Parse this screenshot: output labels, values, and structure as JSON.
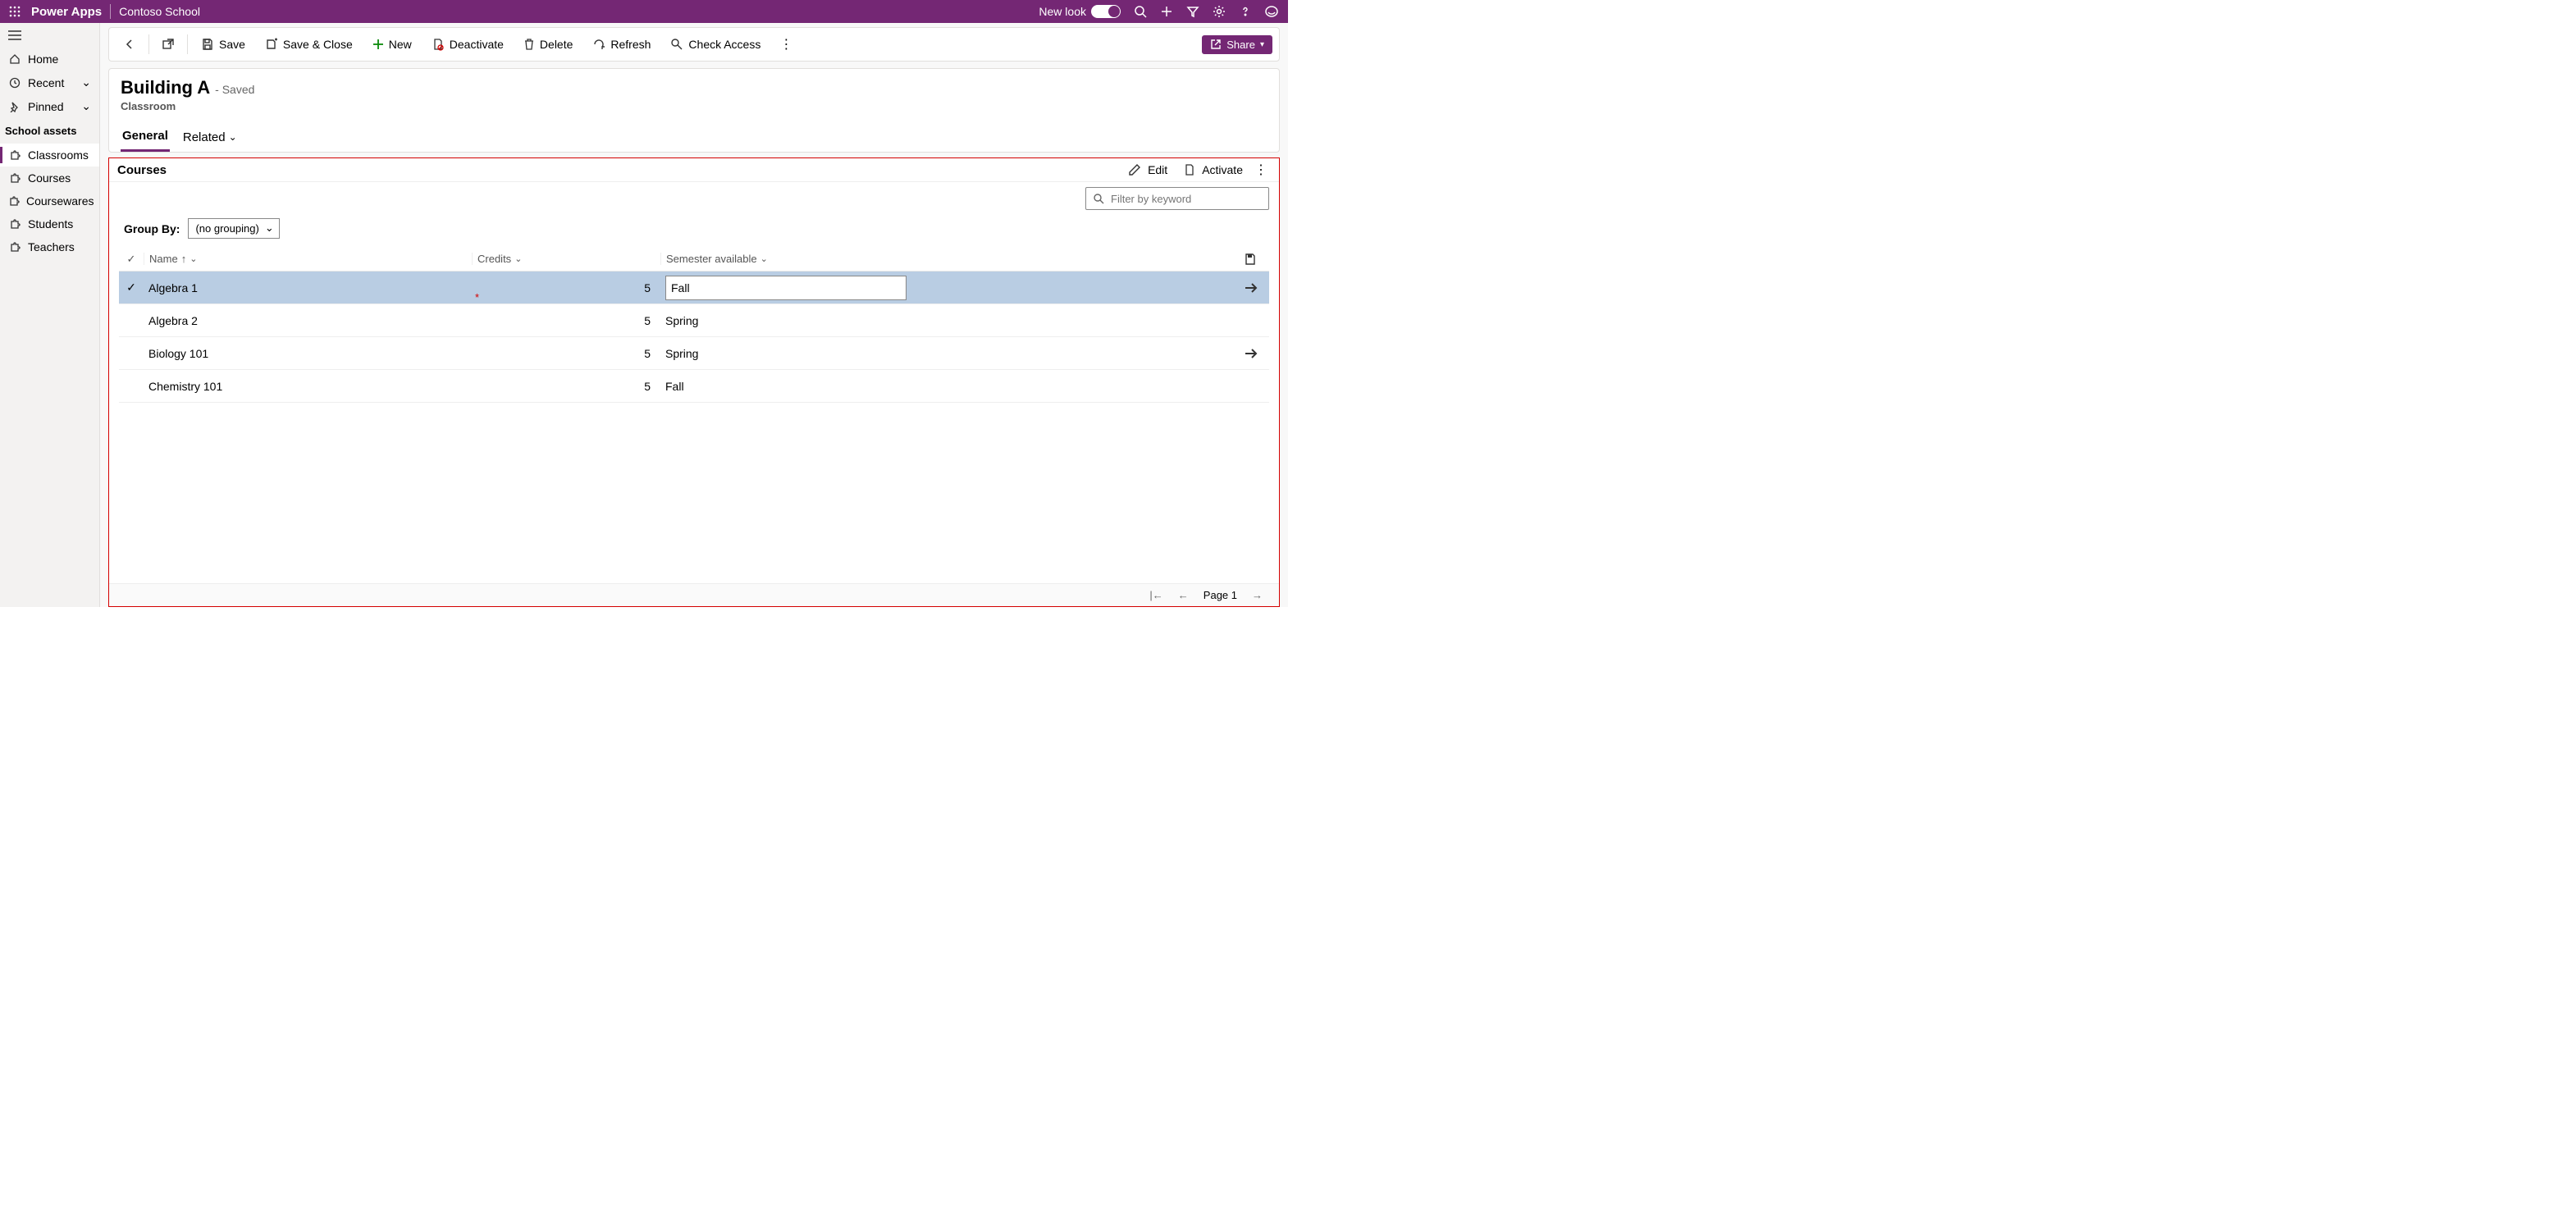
{
  "header": {
    "app_name": "Power Apps",
    "org_name": "Contoso School",
    "new_look": "New look"
  },
  "sidebar": {
    "home": "Home",
    "recent": "Recent",
    "pinned": "Pinned",
    "group": "School assets",
    "items": [
      "Classrooms",
      "Courses",
      "Coursewares",
      "Students",
      "Teachers"
    ]
  },
  "commands": {
    "save": "Save",
    "save_close": "Save & Close",
    "new": "New",
    "deactivate": "Deactivate",
    "delete": "Delete",
    "refresh": "Refresh",
    "check_access": "Check Access",
    "share": "Share"
  },
  "form": {
    "title": "Building A",
    "status": "- Saved",
    "entity": "Classroom",
    "tabs": {
      "general": "General",
      "related": "Related"
    }
  },
  "subgrid": {
    "title": "Courses",
    "edit": "Edit",
    "activate": "Activate",
    "filter_placeholder": "Filter by keyword",
    "group_by_label": "Group By:",
    "group_by_value": "(no grouping)",
    "columns": {
      "name": "Name",
      "credits": "Credits",
      "semester": "Semester available"
    },
    "rows": [
      {
        "name": "Algebra 1",
        "credits": "5",
        "semester": "Fall",
        "selected": true,
        "editing": true,
        "arrow": true
      },
      {
        "name": "Algebra 2",
        "credits": "5",
        "semester": "Spring",
        "selected": false,
        "arrow": false
      },
      {
        "name": "Biology 101",
        "credits": "5",
        "semester": "Spring",
        "selected": false,
        "arrow": true
      },
      {
        "name": "Chemistry 101",
        "credits": "5",
        "semester": "Fall",
        "selected": false,
        "arrow": false
      }
    ],
    "page": "Page 1"
  }
}
